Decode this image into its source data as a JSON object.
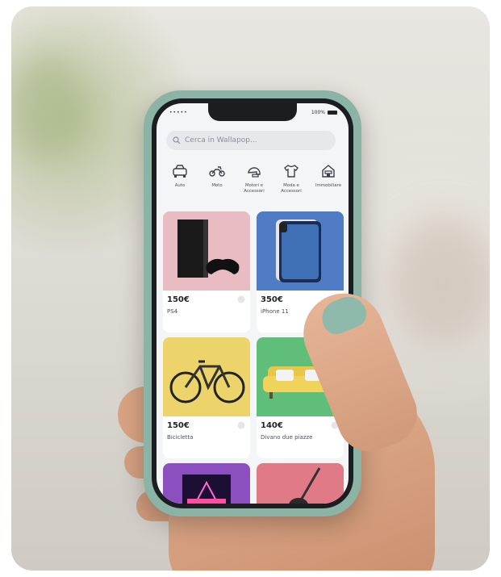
{
  "status_bar": {
    "carrier": "•••••",
    "battery": "100%"
  },
  "search": {
    "placeholder": "Cerca in Wallapop..."
  },
  "categories": [
    {
      "label": "Auto",
      "icon": "car-icon"
    },
    {
      "label": "Moto",
      "icon": "motorbike-icon"
    },
    {
      "label": "Motori e\nAccessori",
      "icon": "helmet-icon"
    },
    {
      "label": "Moda e\nAccessori",
      "icon": "tshirt-icon"
    },
    {
      "label": "Immobiliare",
      "icon": "building-icon"
    }
  ],
  "products": [
    {
      "price": "150€",
      "title": "PS4",
      "bg": "#e9bcc4"
    },
    {
      "price": "350€",
      "title": "iPhone 11",
      "bg": "#4f7cc4"
    },
    {
      "price": "150€",
      "title": "Bicicletta",
      "bg": "#ecd36a"
    },
    {
      "price": "140€",
      "title": "Divano due piazze",
      "bg": "#5fbf7a"
    },
    {
      "price": "",
      "title": "",
      "bg": "#8b4fc0"
    },
    {
      "price": "",
      "title": "",
      "bg": "#e07a86"
    }
  ],
  "colors": {
    "phone_case": "#8bb3a6",
    "screen_bg": "#f4f5f7",
    "search_bg": "#e6e8ec"
  }
}
